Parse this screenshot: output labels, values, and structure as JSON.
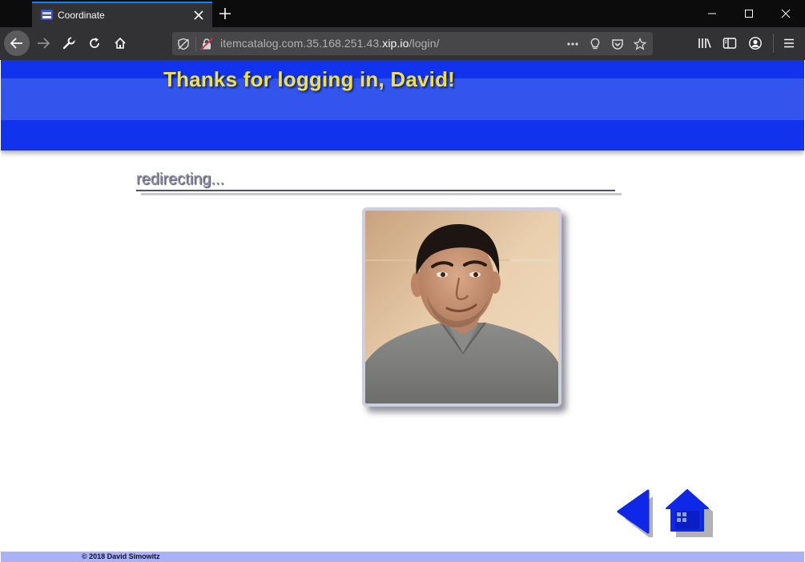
{
  "browser": {
    "tab_title": "Coordinate",
    "url_prefix": "itemcatalog.com.35.168.251.43.",
    "url_domain": "xip.io",
    "url_path": "/login/",
    "icons": [
      "back-arrow-icon",
      "forward-arrow-icon",
      "wrench-icon",
      "reload-icon",
      "home-icon",
      "tracking-protection-icon",
      "insecure-lock-icon",
      "page-actions-icon",
      "lightbulb-icon",
      "pocket-icon",
      "bookmark-star-icon",
      "library-icon",
      "sidebar-icon",
      "account-icon",
      "menu-icon"
    ]
  },
  "page": {
    "heading": "Thanks for logging in, David!",
    "status": "redirecting...",
    "footer": "© 2018 David Simowitz"
  },
  "colors": {
    "banner": "#1133ee",
    "banner_band": "#3355ee",
    "heading": "#f2e04a",
    "footer_bar": "#a9b2f7",
    "nav_buttons": "#0f27e6"
  }
}
